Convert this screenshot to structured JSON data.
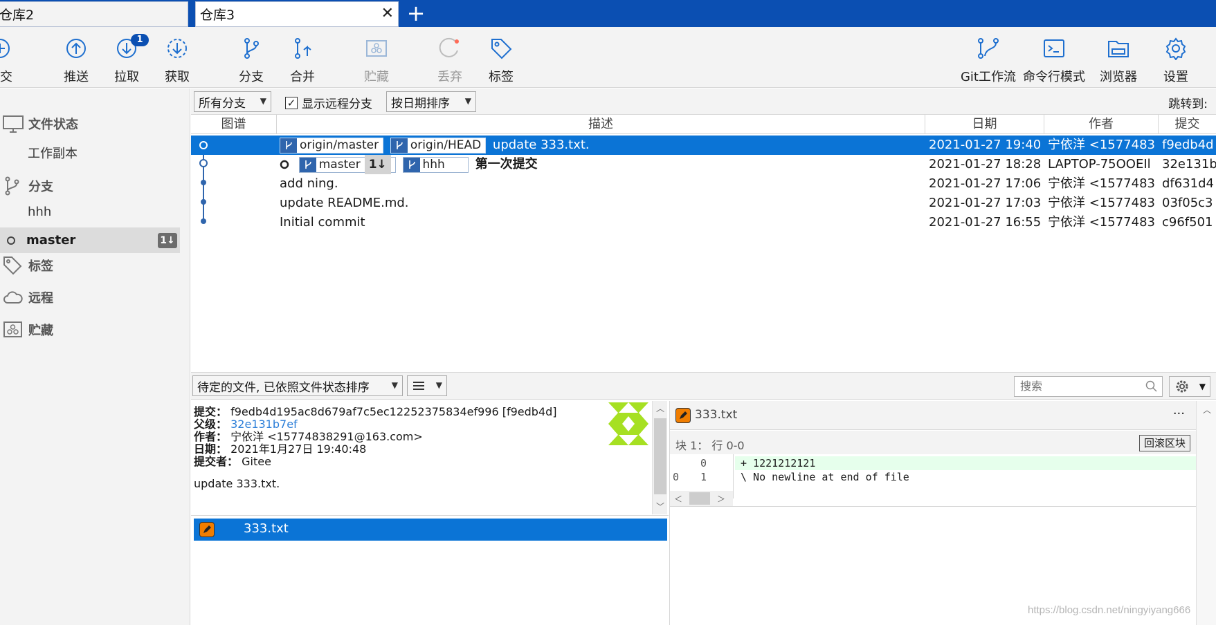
{
  "tabs": [
    {
      "label": "仓库2"
    },
    {
      "label": "仓库3",
      "close": "✕"
    }
  ],
  "tab_add": "+",
  "toolbar": {
    "commit": "提交",
    "push": "推送",
    "pull": "拉取",
    "pull_badge": "1",
    "fetch": "获取",
    "branch": "分支",
    "merge": "合并",
    "stash": "贮藏",
    "discard": "丢弃",
    "tag": "标签",
    "git_flow": "Git工作流",
    "terminal": "命令行模式",
    "explorer": "浏览器",
    "settings": "设置"
  },
  "sidebar": {
    "file_status": "文件状态",
    "working_copy": "工作副本",
    "branches": "分支",
    "branch_hhh": "hhh",
    "branch_master": "master",
    "master_badge": "1↓",
    "tags": "标签",
    "remotes": "远程",
    "stashes": "贮藏"
  },
  "filter": {
    "branches": "所有分支",
    "show_remote": "显示远程分支",
    "show_remote_checked": "✓",
    "sort": "按日期排序",
    "jump": "跳转到:"
  },
  "columns": {
    "graph": "图谱",
    "description": "描述",
    "date": "日期",
    "author": "作者",
    "commit": "提交"
  },
  "commits": [
    {
      "tags": [
        "origin/master",
        "origin/HEAD"
      ],
      "message": "update 333.txt.",
      "date": "2021-01-27 19:40",
      "author": "宁依洋 <1577483",
      "hash": "f9edb4d"
    },
    {
      "tags": [
        "master",
        "hhh"
      ],
      "master_sync": "1↓",
      "message": "第一次提交",
      "date": "2021-01-27 18:28",
      "author": "LAPTOP-75OOEIl",
      "hash": "32e131b"
    },
    {
      "message": "add ning.",
      "date": "2021-01-27 17:06",
      "author": "宁依洋 <1577483",
      "hash": "df631d4"
    },
    {
      "message": "update README.md.",
      "date": "2021-01-27 17:03",
      "author": "宁依洋 <1577483",
      "hash": "03f05c3"
    },
    {
      "message": "Initial commit",
      "date": "2021-01-27 16:55",
      "author": "宁依洋 <1577483",
      "hash": "c96f501"
    }
  ],
  "bottom": {
    "pending_sort": "待定的文件, 已依照文件状态排序",
    "search_placeholder": "搜索"
  },
  "details": {
    "commit_label": "提交：",
    "commit_value": "f9edb4d195ac8d679af7c5ec12252375834ef996 [f9edb4d]",
    "parent_label": "父级：",
    "parent_value": "32e131b7ef",
    "author_label": "作者：",
    "author_value": "宁依洋 <15774838291@163.com>",
    "date_label": "日期：",
    "date_value": "2021年1月27日 19:40:48",
    "committer_label": "提交者：",
    "committer_value": "Gitee",
    "message": "update 333.txt."
  },
  "files": [
    {
      "name": "333.txt"
    }
  ],
  "diff": {
    "file": "333.txt",
    "more": "···",
    "hunk": "块 1： 行 0-0",
    "revert": "回滚区块",
    "lines": [
      {
        "old": "",
        "new": "0",
        "text": "+ 1221212121",
        "type": "add"
      },
      {
        "old": "0",
        "new": "1",
        "text": "\\  No newline at end of file",
        "type": "context"
      }
    ]
  },
  "watermark": "https://blog.csdn.net/ningyiyang666",
  "colors": {
    "accent": "#0b4fb2",
    "selection": "#0b74d6",
    "add_line": "#e6ffec",
    "pencil": "#f07d00"
  }
}
